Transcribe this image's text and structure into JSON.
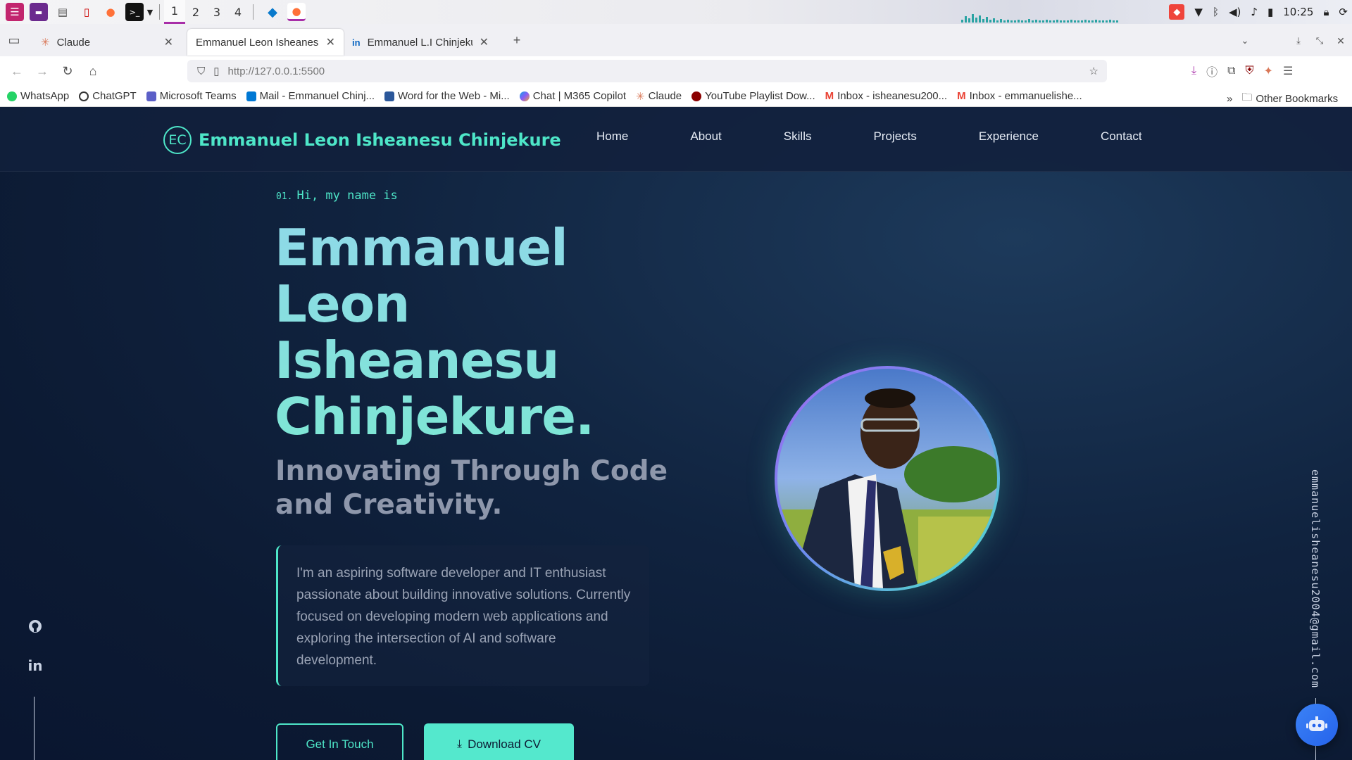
{
  "taskbar": {
    "workspaces": [
      "1",
      "2",
      "3",
      "4"
    ],
    "clock": "10:25"
  },
  "browser": {
    "tabs": [
      {
        "label": "Claude"
      },
      {
        "label": "Emmanuel Leon Isheanesu C"
      },
      {
        "label": "Emmanuel L.I Chinjekure"
      }
    ],
    "url": "http://127.0.0.1:5500",
    "bookmarks": [
      {
        "label": "WhatsApp",
        "color": "#25d366"
      },
      {
        "label": "ChatGPT",
        "color": "#333333"
      },
      {
        "label": "Microsoft Teams",
        "color": "#5b5fc7"
      },
      {
        "label": "Mail - Emmanuel Chinj...",
        "color": "#0078d4"
      },
      {
        "label": "Word for the Web - Mi...",
        "color": "#2b579a"
      },
      {
        "label": "Chat | M365 Copilot",
        "color": "#8a5cf6"
      },
      {
        "label": "Claude",
        "color": "#d97757"
      },
      {
        "label": "YouTube Playlist Dow...",
        "color": "#cc0000"
      },
      {
        "label": "Inbox - isheanesu200...",
        "color": "#ea4335"
      },
      {
        "label": "Inbox - emmanuelishe...",
        "color": "#ea4335"
      }
    ],
    "other_bookmarks": "Other Bookmarks"
  },
  "site": {
    "logo_initials": "EC",
    "logo_name": "Emmanuel Leon Isheanesu Chinjekure",
    "nav": [
      "Home",
      "About",
      "Skills",
      "Projects",
      "Experience",
      "Contact"
    ],
    "greeting_num": "01.",
    "greeting": "Hi, my name is",
    "name_lines": [
      "Emmanuel",
      "Leon",
      "Isheanesu",
      "Chinjekure."
    ],
    "subtitle": "Innovating Through Code and Creativity.",
    "description": "I'm an aspiring software developer and IT enthusiast passionate about building innovative solutions. Currently focused on developing modern web applications and exploring the intersection of AI and software development.",
    "btn_touch": "Get In Touch",
    "btn_cv": "Download CV",
    "email": "emmanuelisheanesu2004@gmail.com",
    "accent": "#4ee6c8"
  }
}
